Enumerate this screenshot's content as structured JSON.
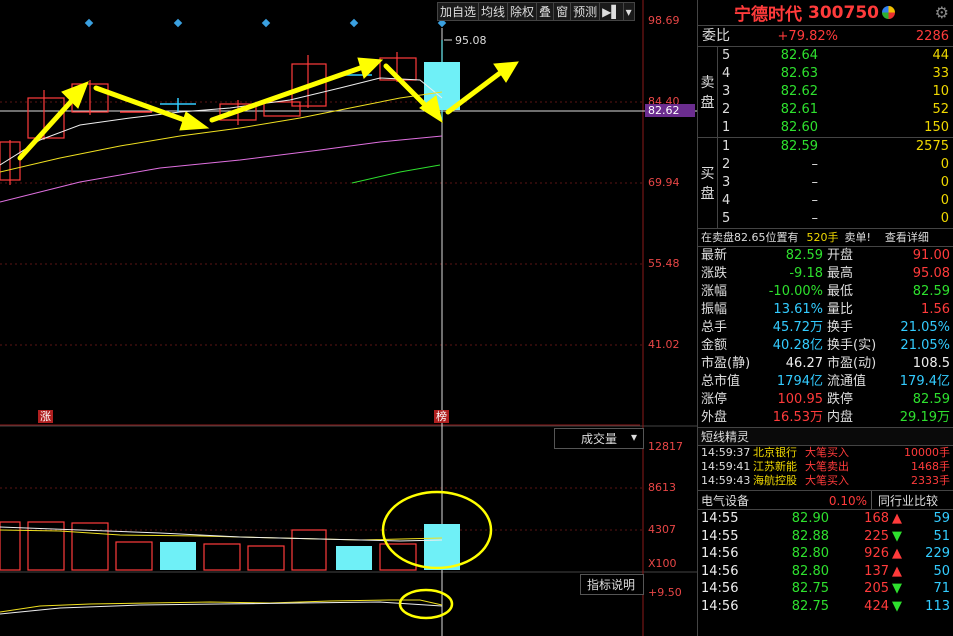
{
  "toolbar": {
    "buttons": [
      "加自选",
      "均线",
      "除权",
      "叠",
      "窗",
      "预测"
    ],
    "arrow_icon": "play-menu-icon",
    "dropdown_icon": "triangle-down-icon"
  },
  "chart_data": [
    {
      "type": "candlestick",
      "price_axis_labels": [
        "98.69",
        "84.40",
        "69.94",
        "55.48",
        "41.02"
      ],
      "current_price_label": "82.62",
      "high_marker_label": "95.08",
      "limit_tags": [
        "涨",
        "榜"
      ]
    },
    {
      "type": "bar",
      "indicator_selector": "成交量",
      "volume_axis_labels": [
        "12817",
        "8613",
        "4307",
        "X100"
      ]
    },
    {
      "type": "line",
      "indicator_button": "指标说明",
      "axis_label": "+9.50"
    }
  ],
  "quote": {
    "name": "宁德时代",
    "code": "300750",
    "weibi_label": "委比",
    "weibi_pct": "+79.82%",
    "weibi_num": "2286",
    "sell_side": [
      "卖",
      "盘"
    ],
    "buy_side": [
      "买",
      "盘"
    ],
    "sell": [
      {
        "lvl": "5",
        "px": "82.64",
        "vol": "44"
      },
      {
        "lvl": "4",
        "px": "82.63",
        "vol": "33"
      },
      {
        "lvl": "3",
        "px": "82.62",
        "vol": "10"
      },
      {
        "lvl": "2",
        "px": "82.61",
        "vol": "52"
      },
      {
        "lvl": "1",
        "px": "82.60",
        "vol": "150"
      }
    ],
    "buy": [
      {
        "lvl": "1",
        "px": "82.59",
        "vol": "2575"
      },
      {
        "lvl": "2",
        "px": "–",
        "vol": "0"
      },
      {
        "lvl": "3",
        "px": "–",
        "vol": "0"
      },
      {
        "lvl": "4",
        "px": "–",
        "vol": "0"
      },
      {
        "lvl": "5",
        "px": "–",
        "vol": "0"
      }
    ],
    "notice": {
      "a": "在卖盘82.65位置有",
      "b": "520手",
      "c": "卖单!",
      "d": "查看详细"
    },
    "stats": [
      {
        "k": "最新",
        "v": "82.59",
        "vc": "green",
        "k2": "开盘",
        "v2": "91.00",
        "v2c": "red"
      },
      {
        "k": "涨跌",
        "v": "-9.18",
        "vc": "green",
        "k2": "最高",
        "v2": "95.08",
        "v2c": "red"
      },
      {
        "k": "涨幅",
        "v": "-10.00%",
        "vc": "green",
        "k2": "最低",
        "v2": "82.59",
        "v2c": "green"
      },
      {
        "k": "振幅",
        "v": "13.61%",
        "vc": "cyan",
        "k2": "量比",
        "v2": "1.56",
        "v2c": "red"
      },
      {
        "k": "总手",
        "v": "45.72万",
        "vc": "cyan",
        "k2": "换手",
        "v2": "21.05%",
        "v2c": "cyan"
      },
      {
        "k": "金额",
        "v": "40.28亿",
        "vc": "cyan",
        "k2": "换手(实)",
        "v2": "21.05%",
        "v2c": "cyan"
      },
      {
        "k": "市盈(静)",
        "v": "46.27",
        "vc": "white",
        "k2": "市盈(动)",
        "v2": "108.5",
        "v2c": "white"
      },
      {
        "k": "总市值",
        "v": "1794亿",
        "vc": "cyan",
        "k2": "流通值",
        "v2": "179.4亿",
        "v2c": "cyan"
      },
      {
        "k": "涨停",
        "v": "100.95",
        "vc": "red",
        "k2": "跌停",
        "v2": "82.59",
        "v2c": "green"
      },
      {
        "k": "外盘",
        "v": "16.53万",
        "vc": "red",
        "k2": "内盘",
        "v2": "29.19万",
        "v2c": "green"
      }
    ],
    "spirit_title": "短线精灵",
    "spirit": [
      {
        "t": "14:59:37",
        "s": "北京银行",
        "e": "大笔买入",
        "q": "10000手"
      },
      {
        "t": "14:59:41",
        "s": "江苏新能",
        "e": "大笔卖出",
        "q": "1468手"
      },
      {
        "t": "14:59:43",
        "s": "海航控股",
        "e": "大笔买入",
        "q": "2333手"
      }
    ],
    "industry": {
      "name": "电气设备",
      "pct": "0.10%",
      "btn": "同行业比较"
    },
    "ticks": [
      {
        "tm": "14:55",
        "px": "82.90",
        "vl": "168",
        "dir": "up",
        "n": "59"
      },
      {
        "tm": "14:55",
        "px": "82.88",
        "vl": "225",
        "dir": "dn",
        "n": "51"
      },
      {
        "tm": "14:56",
        "px": "82.80",
        "vl": "926",
        "dir": "up",
        "n": "229"
      },
      {
        "tm": "14:56",
        "px": "82.80",
        "vl": "137",
        "dir": "up",
        "n": "50"
      },
      {
        "tm": "14:56",
        "px": "82.75",
        "vl": "205",
        "dir": "dn",
        "n": "71"
      },
      {
        "tm": "14:56",
        "px": "82.75",
        "vl": "424",
        "dir": "dn",
        "n": "113"
      }
    ]
  }
}
